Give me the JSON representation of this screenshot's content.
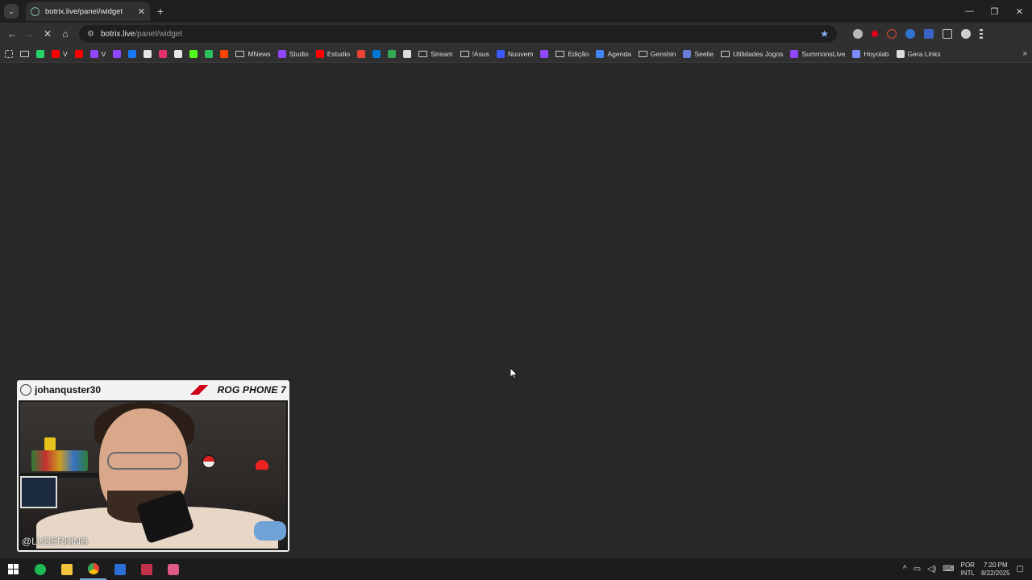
{
  "browser": {
    "tab_title": "botrix.live/panel/widget",
    "tab_close": "✕",
    "new_tab": "+",
    "tab_search_glyph": "⌄",
    "url_host": "botrix.live",
    "url_path": "/panel/widget",
    "window_controls": [
      "—",
      "❐",
      "✕"
    ]
  },
  "bookmarks": [
    {
      "label": "",
      "icon": "apps-grid-icon",
      "color": "#cfcfcf"
    },
    {
      "label": "",
      "icon": "folder-icon",
      "color": "#cfcfcf"
    },
    {
      "label": "",
      "icon": "whatsapp-icon",
      "color": "#25d366"
    },
    {
      "label": "V",
      "icon": "youtube-icon",
      "color": "#ff0000"
    },
    {
      "label": "",
      "icon": "youtube-icon",
      "color": "#ff0000"
    },
    {
      "label": "V",
      "icon": "twitch-icon",
      "color": "#9146ff"
    },
    {
      "label": "",
      "icon": "twitch-icon",
      "color": "#9146ff"
    },
    {
      "label": "",
      "icon": "facebook-icon",
      "color": "#1877f2"
    },
    {
      "label": "",
      "icon": "x-icon",
      "color": "#e6e6e6"
    },
    {
      "label": "",
      "icon": "instagram-icon",
      "color": "#e1306c"
    },
    {
      "label": "",
      "icon": "tiktok-icon",
      "color": "#e6e6e6"
    },
    {
      "label": "",
      "icon": "kick-icon",
      "color": "#53fc18"
    },
    {
      "label": "",
      "icon": "evernote-icon",
      "color": "#2dbe60"
    },
    {
      "label": "",
      "icon": "reddit-icon",
      "color": "#ff4500"
    },
    {
      "label": "MNews",
      "icon": "folder-icon",
      "color": "#cfcfcf"
    },
    {
      "label": "Studio",
      "icon": "twitch-icon",
      "color": "#9146ff"
    },
    {
      "label": "Estudio",
      "icon": "youtube-icon",
      "color": "#ff0000"
    },
    {
      "label": "",
      "icon": "gmail-icon",
      "color": "#ea4335"
    },
    {
      "label": "",
      "icon": "outlook-icon",
      "color": "#0078d4"
    },
    {
      "label": "",
      "icon": "drive-icon",
      "color": "#34a853"
    },
    {
      "label": "",
      "icon": "layers-icon",
      "color": "#dcdcdc"
    },
    {
      "label": "Stream",
      "icon": "folder-icon",
      "color": "#cfcfcf"
    },
    {
      "label": "!Asus",
      "icon": "folder-icon",
      "color": "#cfcfcf"
    },
    {
      "label": "Nuuvem",
      "icon": "nuuvem-icon",
      "color": "#3d5afe"
    },
    {
      "label": "",
      "icon": "twitch-icon",
      "color": "#9146ff"
    },
    {
      "label": "Edição",
      "icon": "folder-icon",
      "color": "#cfcfcf"
    },
    {
      "label": "Agenda",
      "icon": "calendar-icon",
      "color": "#4285f4"
    },
    {
      "label": "Genshin",
      "icon": "folder-icon",
      "color": "#cfcfcf"
    },
    {
      "label": "Seelie",
      "icon": "seelie-icon",
      "color": "#6a7bd8"
    },
    {
      "label": "Utilidades Jogos",
      "icon": "folder-icon",
      "color": "#cfcfcf"
    },
    {
      "label": "SummonsLive",
      "icon": "summons-icon",
      "color": "#9146ff"
    },
    {
      "label": "Hoyolab",
      "icon": "hoyolab-icon",
      "color": "#7c8cff"
    },
    {
      "label": "Gera Links",
      "icon": "globe-icon",
      "color": "#dcdcdc"
    }
  ],
  "bookmarks_more": "»",
  "widget": {
    "username": "johanquster30",
    "brand": "ROG PHONE 7",
    "cam_tag": "@LUDERKING"
  },
  "taskbar": {
    "language": "POR",
    "keyboard": "INTL",
    "time": "7:20 PM",
    "date": "8/22/2025"
  },
  "colors": {
    "accent": "#8ab4f8",
    "page_bg": "#282828"
  }
}
